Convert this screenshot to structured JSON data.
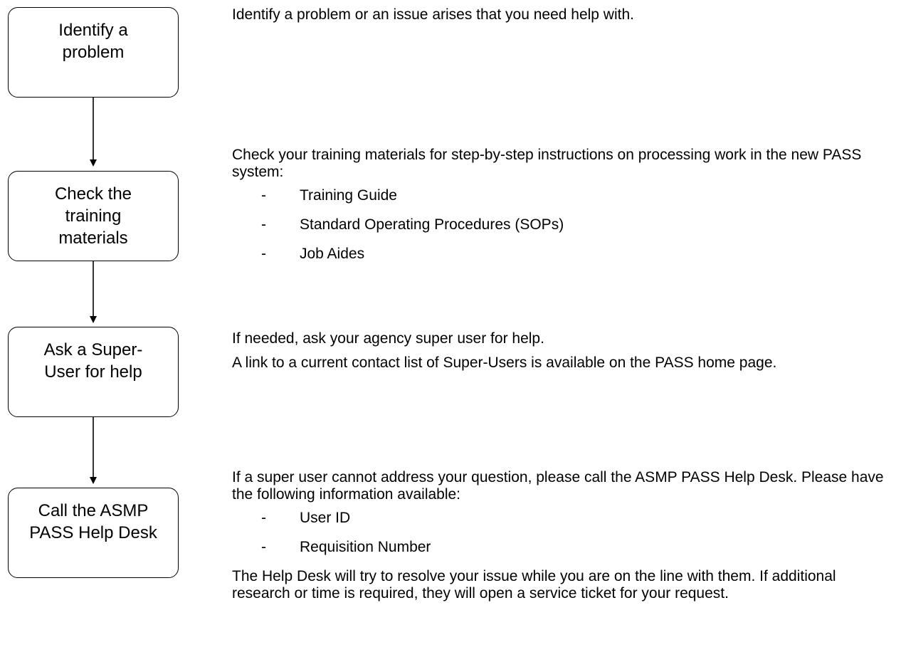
{
  "steps": [
    {
      "label": "Identify a problem"
    },
    {
      "label": "Check the training materials"
    },
    {
      "label": "Ask a Super-User for help"
    },
    {
      "label": "Call the ASMP PASS Help Desk"
    }
  ],
  "descriptions": {
    "identify": {
      "text": "Identify a problem or an issue arises that you need help with."
    },
    "training": {
      "intro": "Check your training materials for step-by-step instructions on processing work in the new PASS system:",
      "items": [
        "Training Guide",
        "Standard Operating Procedures (SOPs)",
        "Job Aides"
      ]
    },
    "super_user": {
      "line1": "If needed, ask your agency super user for help.",
      "line2": "A link to a current contact list of Super-Users is available on the PASS home page."
    },
    "help_desk": {
      "intro": "If a super user cannot address your question, please call the ASMP PASS Help Desk.  Please have the following information available:",
      "items": [
        "User ID",
        "Requisition Number"
      ],
      "closing": "The Help Desk will try to resolve your issue while you are on the line with them. If additional research or time is required, they will open a service ticket for your request."
    }
  },
  "bullet_marker": "-"
}
